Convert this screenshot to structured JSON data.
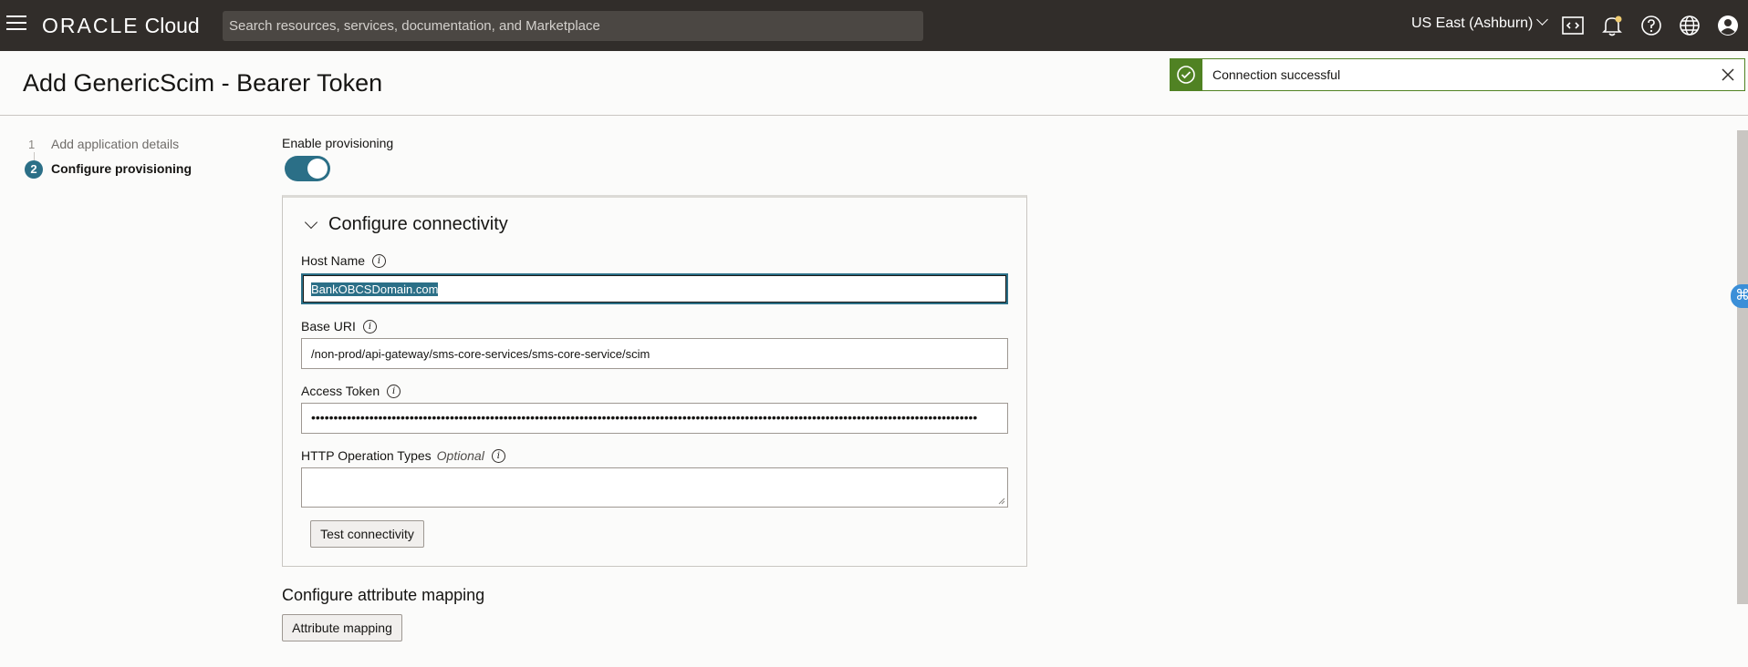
{
  "header": {
    "logo_brand": "ORACLE",
    "logo_product": "Cloud",
    "search_placeholder": "Search resources, services, documentation, and Marketplace",
    "region": "US East (Ashburn)",
    "icons": [
      "menu-icon",
      "code-editor-icon",
      "bell-icon",
      "help-icon",
      "globe-icon",
      "profile-icon"
    ]
  },
  "page": {
    "title": "Add GenericScim - Bearer Token"
  },
  "toast": {
    "message": "Connection successful",
    "color": "#508223"
  },
  "steps": [
    {
      "number": "1",
      "label": "Add application details",
      "active": false
    },
    {
      "number": "2",
      "label": "Configure provisioning",
      "active": true
    }
  ],
  "provisioning": {
    "enable_label": "Enable provisioning",
    "enabled": true
  },
  "connectivity": {
    "title": "Configure connectivity",
    "host_name_label": "Host Name",
    "host_name_value": "BankOBCSDomain.com",
    "base_uri_label": "Base URI",
    "base_uri_value": "/non-prod/api-gateway/sms-core-services/sms-core-service/scim",
    "access_token_label": "Access Token",
    "access_token_masked": "•••••••••••••••••••••••••••••••••••••••••••••••••••••••••••••••••••••••••••••••••••••••••••••••••••••••••••••••••••••••••••••••••••••••••••••••••••••",
    "http_ops_label": "HTTP Operation Types",
    "http_ops_optional": "Optional",
    "http_ops_value": "",
    "test_button": "Test connectivity"
  },
  "attribute_mapping": {
    "title": "Configure attribute mapping",
    "button": "Attribute mapping"
  },
  "colors": {
    "header_bg": "#312d2a",
    "accent": "#2b6f87",
    "success": "#508223"
  }
}
